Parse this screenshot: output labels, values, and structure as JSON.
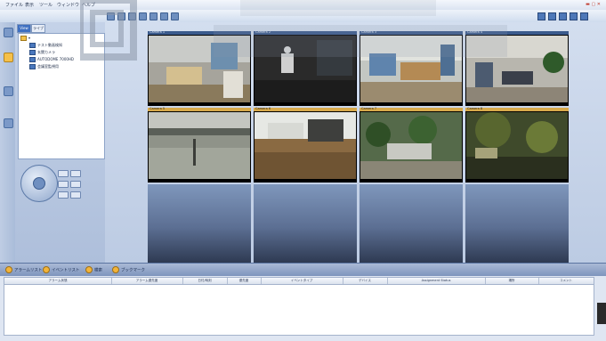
{
  "menubar": {
    "items": [
      "ファイル",
      "表示",
      "ツール",
      "ウィンドウ",
      "ヘルプ"
    ]
  },
  "tree": {
    "tabs": [
      "View",
      "ライブ"
    ],
    "items": [
      "テスト動画検知",
      "玄関カメラ",
      "AUTODOME 7000HD",
      "会議室監視用"
    ]
  },
  "cameras": [
    {
      "label": "Camera 1",
      "scene": "office"
    },
    {
      "label": "Camera 2",
      "scene": "lobby"
    },
    {
      "label": "Camera 3",
      "scene": "office"
    },
    {
      "label": "Camera 4",
      "scene": "hall"
    },
    {
      "label": "Camera 5",
      "scene": "outdoor"
    },
    {
      "label": "Camera 6",
      "scene": "room"
    },
    {
      "label": "Camera 7",
      "scene": "garden"
    },
    {
      "label": "Camera 8",
      "scene": "night"
    }
  ],
  "bottom": {
    "tabs": [
      "アラームリスト",
      "イベントリスト",
      "検索",
      "ブックマーク"
    ],
    "columns": [
      "アラーム状態",
      "アラーム優先度",
      "日付/時刻",
      "優先度",
      "イベントタイプ",
      "デバイス",
      "Assignment Status",
      "場所",
      "コメント"
    ]
  },
  "colors": {
    "accent": "#3e6fc0",
    "cell_header": "#d7a94a"
  }
}
